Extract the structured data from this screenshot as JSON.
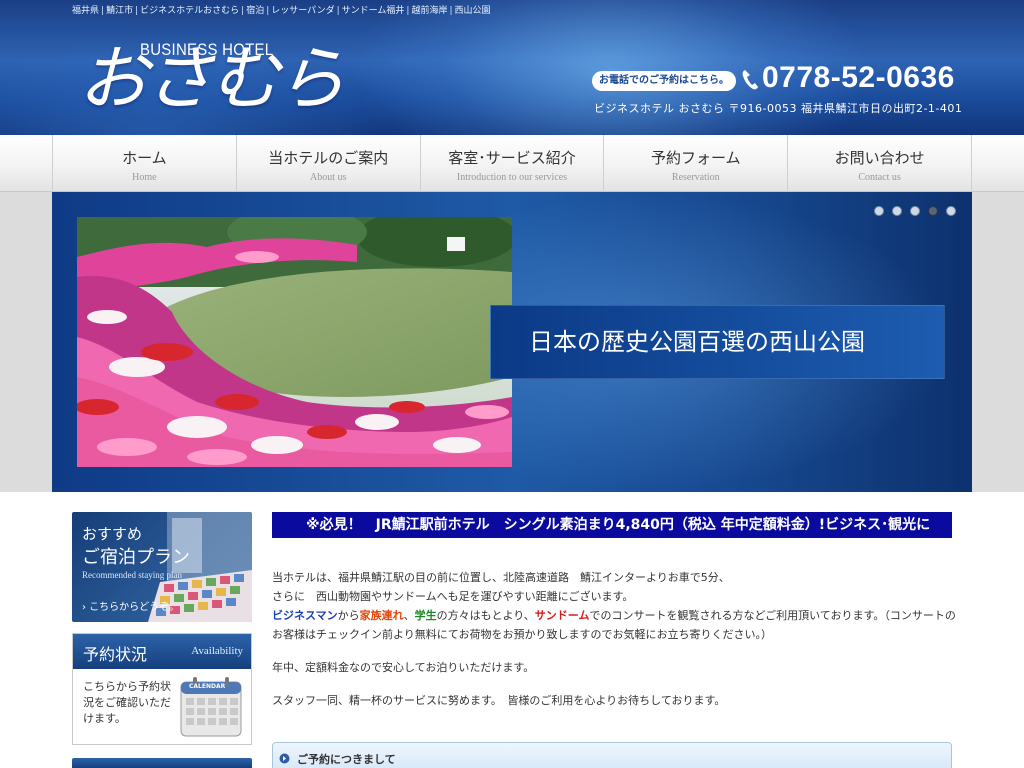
{
  "breadcrumb": [
    "福井県",
    "鯖江市",
    "ビジネスホテルおさむら",
    "宿泊",
    "レッサーパンダ",
    "サンドーム福井",
    "越前海岸",
    "西山公園"
  ],
  "header": {
    "logo_en": "BUSINESS HOTEL",
    "logo_jp": "おさむら",
    "tel_badge": "お電話でのご予約はこちら。",
    "tel_number": "0778-52-0636",
    "address": "ビジネスホテル おさむら 〒916-0053 福井県鯖江市日の出町2-1-401"
  },
  "nav": [
    {
      "jp": "ホーム",
      "en": "Home"
    },
    {
      "jp": "当ホテルのご案内",
      "en": "About us"
    },
    {
      "jp": "客室･サービス紹介",
      "en": "Introduction to our services"
    },
    {
      "jp": "予約フォーム",
      "en": "Reservation"
    },
    {
      "jp": "お問い合わせ",
      "en": "Contact us"
    }
  ],
  "slider": {
    "caption": "日本の歴史公園百選の西山公園",
    "slide_count": 5,
    "active_index": 3
  },
  "sidebar": {
    "plan": {
      "line1": "おすすめ",
      "line2": "ご宿泊プラン",
      "en": "Recommended staying plan",
      "link": "› こちらからどうぞ。"
    },
    "availability": {
      "title": "予約状況",
      "en": "Availability",
      "body": "こちらから予約状況をご確認いただけます。",
      "calendar_label": "CALENDAR"
    }
  },
  "main": {
    "marquee": "※必見！　JR鯖江駅前ホテル　シングル素泊まり4,840円（税込 年中定額料金）!ビジネス･観光に",
    "intro": {
      "p1_line1": "当ホテルは、福井県鯖江駅の目の前に位置し、北陸高速道路　鯖江インターよりお車で5分、",
      "p1_line2": "さらに　西山動物園やサンドームへも足を運びやすい距離にございます。",
      "kw_business": "ビジネスマン",
      "t_kara": "から",
      "kw_family": "家族連れ",
      "t_comma": "、",
      "kw_student": "学生",
      "t_mid": "の方々はもとより、",
      "kw_sandome": "サンドーム",
      "t_rest": "でのコンサートを観覧される方などご利用頂いております。（コンサートのお客様はチェックイン前より無料にてお荷物をお預かり致しますのでお気軽にお立ち寄りください。）",
      "p3": "年中、定額料金なので安心してお泊りいただけます。",
      "p4": "スタッフ一同、精一杯のサービスに努めます。　皆様のご利用を心よりお待ちしております。"
    },
    "reserve_title": "ご予約につきまして"
  },
  "colors": {
    "header_blue": "#1b3f86",
    "marquee_bg": "#0a0a9e",
    "accent_orange": "#e2460a",
    "accent_green": "#1e8a23",
    "accent_red": "#d41b1b",
    "accent_blue": "#1a3fb5"
  }
}
